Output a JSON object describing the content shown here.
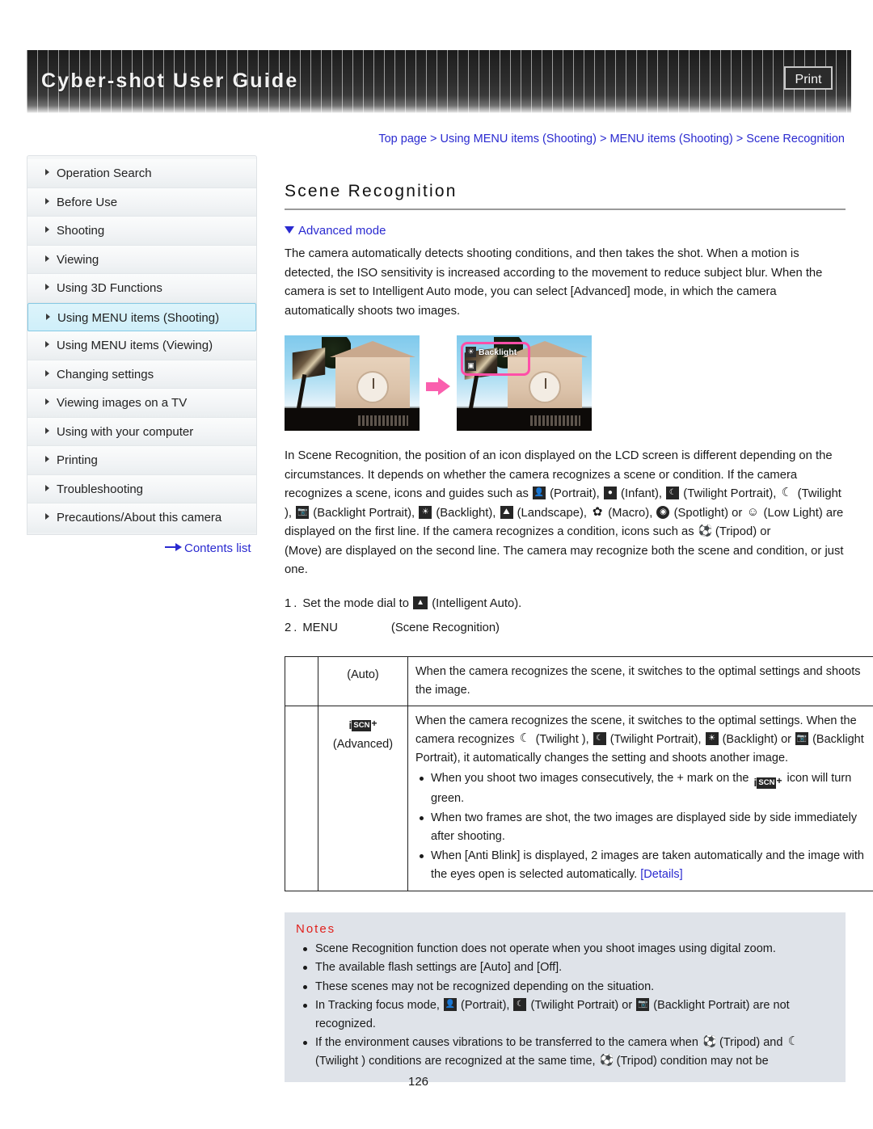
{
  "header": {
    "title": "Cyber-shot User Guide",
    "print_label": "Print"
  },
  "breadcrumb": {
    "text": "Top page > Using MENU items (Shooting) > MENU items (Shooting) > Scene Recognition"
  },
  "sidebar": {
    "items": [
      {
        "label": "Operation Search",
        "active": false
      },
      {
        "label": "Before Use",
        "active": false
      },
      {
        "label": "Shooting",
        "active": false
      },
      {
        "label": "Viewing",
        "active": false
      },
      {
        "label": "Using 3D Functions",
        "active": false
      },
      {
        "label": "Using MENU items (Shooting)",
        "active": true
      },
      {
        "label": "Using MENU items (Viewing)",
        "active": false
      },
      {
        "label": "Changing settings",
        "active": false
      },
      {
        "label": "Viewing images on a TV",
        "active": false
      },
      {
        "label": "Using with your computer",
        "active": false
      },
      {
        "label": "Printing",
        "active": false
      },
      {
        "label": "Troubleshooting",
        "active": false
      },
      {
        "label": "Precautions/About this camera",
        "active": false
      }
    ],
    "contents_link": "Contents list"
  },
  "main": {
    "title": "Scene Recognition",
    "advanced_mode_link": "Advanced mode",
    "intro_paragraph": "The camera automatically detects shooting conditions, and then takes the shot. When a motion is detected, the ISO sensitivity is increased according to the movement to reduce subject blur. When the camera is set to Intelligent Auto mode, you can select [Advanced] mode, in which the camera automatically shoots two images.",
    "figure": {
      "callout_label": "Backlight"
    },
    "icon_paragraph": {
      "part1": "In Scene Recognition, the position of an icon displayed on the LCD screen is different depending on the circumstances. It depends on whether the camera recognizes a scene or condition. If the camera recognizes a scene, icons and guides such as ",
      "t_portrait": "(Portrait),",
      "t_infant": "(Infant),",
      "t_twilight_portrait": "(Twilight Portrait),",
      "t_twilight": "(Twilight ),",
      "t_backlight_portrait": "(Backlight Portrait),",
      "t_backlight": "(Backlight),",
      "t_landscape": "(Landscape),",
      "t_macro": "(Macro),",
      "t_spotlight": "(Spotlight) or",
      "t_lowlight": "(Low Light) are displayed on the first line. If the camera recognizes a condition, icons such as",
      "t_tripod": "(Tripod) or",
      "t_move": "(Move) are displayed on the second line. The camera may recognize both the scene and condition, or just one."
    },
    "steps": [
      {
        "num": "1.",
        "text_before": "Set the mode dial to",
        "text_after": "(Intelligent Auto)."
      },
      {
        "num": "2.",
        "text_before": "MENU",
        "text_after": "(Scene Recognition)"
      }
    ],
    "table": {
      "rows": [
        {
          "label": "(Auto)",
          "desc": "When the camera recognizes the scene, it switches to the optimal settings and shoots the image.",
          "bullets": []
        },
        {
          "label": "(Advanced)",
          "desc_part1": "When the camera recognizes the scene, it switches to the optimal settings. When the camera recognizes",
          "desc_twilight": "(Twilight ),",
          "desc_twilight_portrait": "(Twilight Portrait),",
          "desc_backlight": "(Backlight) or",
          "desc_backlight_portrait": "(Backlight Portrait), it automatically changes the setting and shoots another image.",
          "bullets": [
            {
              "before": "When you shoot two images consecutively, the + mark on the",
              "after": "icon will turn green."
            },
            {
              "before": "When two frames are shot, the two images are displayed side by side immediately after shooting.",
              "after": ""
            },
            {
              "before": "When [Anti Blink] is displayed, 2 images are taken automatically and the image with the eyes open is selected automatically.",
              "after": "[Details]"
            }
          ]
        }
      ]
    },
    "notes": {
      "title": "Notes",
      "items": [
        {
          "text": "Scene Recognition function does not operate when you shoot images using digital zoom."
        },
        {
          "text": "The available flash settings are [Auto] and [Off]."
        },
        {
          "text": "These scenes may not be recognized depending on the situation."
        },
        {
          "prefix": "In Tracking focus mode,",
          "mid1": "(Portrait),",
          "mid2": "(Twilight Portrait) or",
          "suffix": "(Backlight Portrait) are not recognized."
        },
        {
          "prefix2": "If the environment causes vibrations to be transferred to the camera when",
          "mid3": "(Tripod) and",
          "mid4": "(Twilight ) conditions are recognized at the same time,",
          "suffix2": "(Tripod) condition may not be"
        }
      ]
    }
  },
  "footer": {
    "page_number": "126"
  },
  "colors": {
    "link": "#2a2ad0",
    "notes_heading": "#e0201c",
    "notes_background": "#dfe3e9",
    "active_nav": "#cfeffa",
    "callout_pink": "#ff4fa8"
  }
}
